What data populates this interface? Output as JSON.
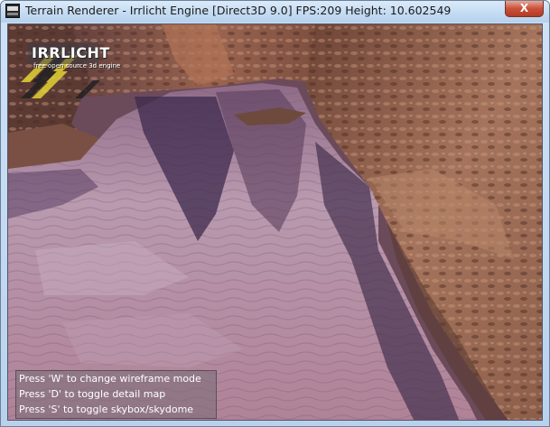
{
  "window": {
    "title": "Terrain Renderer - Irrlicht Engine [Direct3D 9.0] FPS:209 Height: 10.602549",
    "close_label": "X"
  },
  "logo": {
    "name": "IRRLICHT",
    "tagline": "free open source 3d engine"
  },
  "help": {
    "lines": [
      "Press 'W' to change wireframe mode",
      "Press 'D' to toggle detail map",
      "Press 'S' to toggle skybox/skydome"
    ]
  },
  "scene": {
    "description_colors": {
      "water": "#b48a9e",
      "rock": "#8a5a48",
      "shadow_rock": "#4c2e2c",
      "reflection": "#3e2a4e"
    }
  }
}
